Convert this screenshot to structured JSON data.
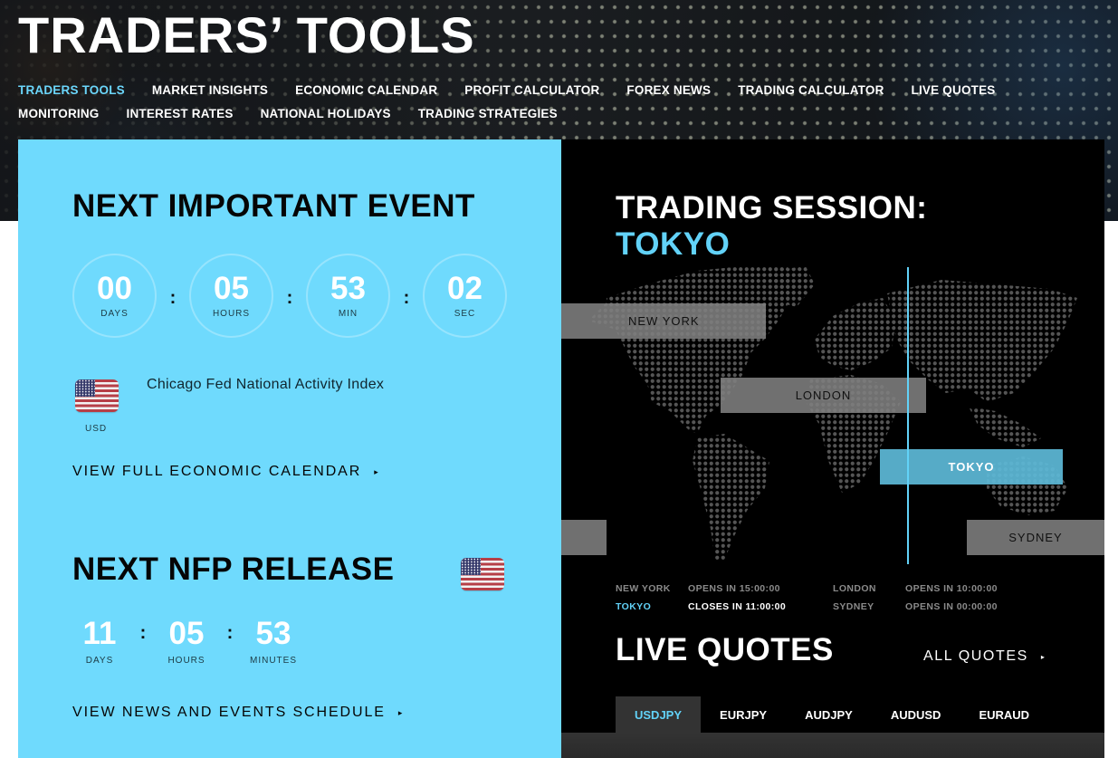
{
  "header": {
    "title": "TRADERS’ TOOLS",
    "nav_rows": [
      [
        {
          "label": "TRADERS TOOLS",
          "active": true
        },
        {
          "label": "MARKET INSIGHTS",
          "active": false
        },
        {
          "label": "ECONOMIC CALENDAR",
          "active": false
        },
        {
          "label": "PROFIT CALCULATOR",
          "active": false
        },
        {
          "label": "FOREX NEWS",
          "active": false
        },
        {
          "label": "TRADING CALCULATOR",
          "active": false
        },
        {
          "label": "LIVE QUOTES",
          "active": false
        }
      ],
      [
        {
          "label": "MONITORING",
          "active": false
        },
        {
          "label": "INTEREST RATES",
          "active": false
        },
        {
          "label": "NATIONAL HOLIDAYS",
          "active": false
        },
        {
          "label": "TRADING STRATEGIES",
          "active": false
        }
      ]
    ]
  },
  "next_event": {
    "title": "NEXT IMPORTANT EVENT",
    "countdown": [
      {
        "value": "00",
        "label": "DAYS"
      },
      {
        "value": "05",
        "label": "HOURS"
      },
      {
        "value": "53",
        "label": "MIN"
      },
      {
        "value": "02",
        "label": "SEC"
      }
    ],
    "separator": ":",
    "flag_icon": "us-flag-icon",
    "currency": "USD",
    "event_name": "Chicago Fed National Activity Index",
    "link_label": "VIEW FULL ECONOMIC CALENDAR",
    "link_arrow": "▸"
  },
  "nfp": {
    "title": "NEXT NFP RELEASE",
    "flag_icon": "us-flag-icon",
    "countdown": [
      {
        "value": "11",
        "label": "DAYS"
      },
      {
        "value": "05",
        "label": "HOURS"
      },
      {
        "value": "53",
        "label": "MINUTES"
      }
    ],
    "separator": ":",
    "link_label": "VIEW NEWS AND EVENTS SCHEDULE",
    "link_arrow": "▸"
  },
  "trading_session": {
    "title": "TRADING SESSION:",
    "current": "TOKYO",
    "sessions": [
      {
        "city": "NEW YORK",
        "active": false
      },
      {
        "city": "LONDON",
        "active": false
      },
      {
        "city": "TOKYO",
        "active": true
      },
      {
        "city": "SYDNEY",
        "active": false
      }
    ],
    "status": [
      [
        {
          "city": "NEW YORK",
          "status": "OPENS IN 15:00:00",
          "active": false
        },
        {
          "city": "LONDON",
          "status": "OPENS IN 10:00:00",
          "active": false
        }
      ],
      [
        {
          "city": "TOKYO",
          "status": "CLOSES IN 11:00:00",
          "active": true
        },
        {
          "city": "SYDNEY",
          "status": "OPENS IN 00:00:00",
          "active": false
        }
      ]
    ]
  },
  "live_quotes": {
    "title": "LIVE QUOTES",
    "all_quotes_label": "ALL QUOTES",
    "all_quotes_arrow": "▸",
    "tabs": [
      {
        "label": "USDJPY",
        "active": true
      },
      {
        "label": "EURJPY",
        "active": false
      },
      {
        "label": "AUDJPY",
        "active": false
      },
      {
        "label": "AUDUSD",
        "active": false
      },
      {
        "label": "EURAUD",
        "active": false
      }
    ]
  },
  "colors": {
    "accent": "#62d2f8",
    "event_panel_bg": "#6fdafd",
    "session_panel_bg": "#000000",
    "session_bar": "#808080",
    "active_session_bar": "#5cb8d6"
  }
}
